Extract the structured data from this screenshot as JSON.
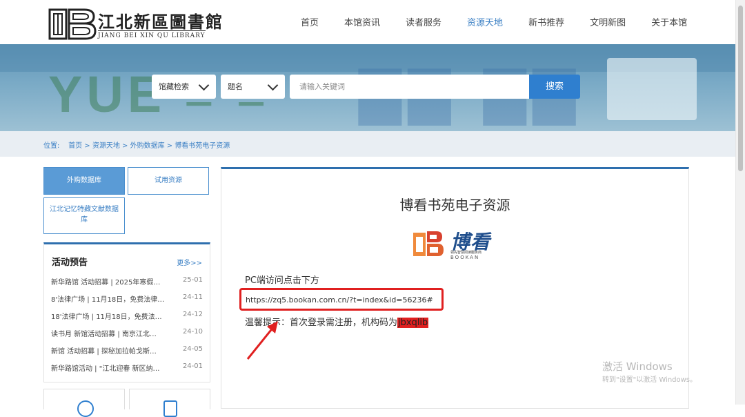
{
  "header": {
    "logo_cn": "江北新區圖書館",
    "logo_en": "JIANG BEI XIN QU LIBRARY",
    "nav": [
      "首页",
      "本馆资讯",
      "读者服务",
      "资源天地",
      "新书推荐",
      "文明新图",
      "关于本馆"
    ],
    "active_nav": "资源天地",
    "accent_color": "#3a7fc4"
  },
  "search": {
    "scope_select": "馆藏检索",
    "field_select": "题名",
    "placeholder": "请输入关键词",
    "button": "搜索"
  },
  "breadcrumb": {
    "label": "位置:",
    "path": "首页 > 资源天地 > 外购数据库 > 博看书苑电子资源"
  },
  "sidebar": {
    "tabs": [
      "外购数据库",
      "试用资源",
      "江北记忆特藏文献数据库"
    ],
    "activity": {
      "title": "活动预告",
      "more": "更多>>",
      "items": [
        {
          "text": "新华路馆 活动招募 | 2025年寒假…",
          "date": "25-01"
        },
        {
          "text": "8'法律广场 | 11月18日，免费法律…",
          "date": "24-11"
        },
        {
          "text": "18'法律广场 | 11月18日，免费法…",
          "date": "24-12"
        },
        {
          "text": "读书月 新馆活动招募 | 南京江北…",
          "date": "24-10"
        },
        {
          "text": "新馆 活动招募 | 探秘加拉帕戈斯…",
          "date": "24-05"
        },
        {
          "text": "新华路馆活动 | \"江北迎春 新区纳…",
          "date": "24-01"
        }
      ]
    }
  },
  "main": {
    "title": "博看书苑电子资源",
    "logo_name": "博看",
    "logo_sub": "领先智慧阅读服务商",
    "logo_en": "BOOKAN",
    "pc_access": "PC端访问点击下方",
    "link": "https://zq5.bookan.com.cn/?t=index&id=56236#",
    "tip_prefix": "温馨提示：首次登录需注册，机构码为",
    "tip_code": "jbxqlib",
    "highlight_color": "#e02020"
  },
  "watermark": {
    "line1": "激活 Windows",
    "line2": "转到\"设置\"以激活 Windows。"
  }
}
